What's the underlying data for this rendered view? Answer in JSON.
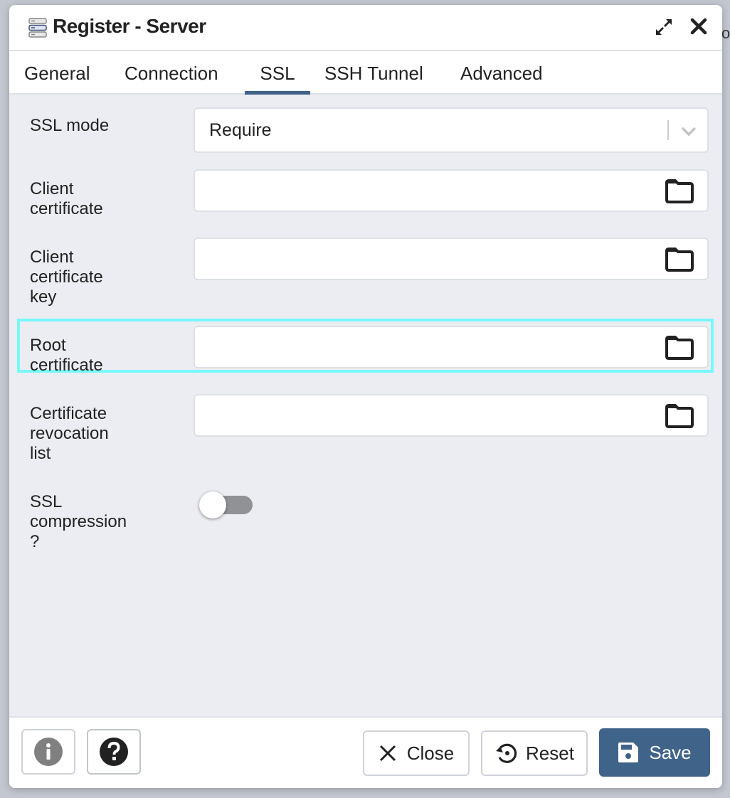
{
  "background_partial_text": "o",
  "dialog": {
    "title": "Register - Server",
    "icons": {
      "title": "server-icon",
      "maximize": "expand-icon",
      "close": "close-icon"
    }
  },
  "tabs": [
    {
      "label": "General",
      "active": false
    },
    {
      "label": "Connection",
      "active": false
    },
    {
      "label": "SSL",
      "active": true
    },
    {
      "label": "SSH Tunnel",
      "active": false
    },
    {
      "label": "Advanced",
      "active": false
    }
  ],
  "form": {
    "ssl_mode": {
      "label": "SSL mode",
      "value": "Require",
      "icon": "chevron-down-icon"
    },
    "client_certificate": {
      "label_lines": [
        "Client",
        "certificate"
      ],
      "value": "",
      "icon": "folder-icon"
    },
    "client_certificate_key": {
      "label_lines": [
        "Client",
        "certificate",
        "key"
      ],
      "value": "",
      "icon": "folder-icon"
    },
    "root_certificate": {
      "label_lines": [
        "Root",
        "certificate"
      ],
      "value": "",
      "icon": "folder-icon",
      "highlighted": true
    },
    "certificate_revocation_list": {
      "label_lines": [
        "Certificate",
        "revocation",
        "list"
      ],
      "value": "",
      "icon": "folder-icon"
    },
    "ssl_compression": {
      "label_lines": [
        "SSL",
        "compression",
        "?"
      ],
      "value": false
    }
  },
  "footer": {
    "info_icon": "info-icon",
    "help_icon": "help-icon",
    "close_label": "Close",
    "reset_label": "Reset",
    "save_label": "Save"
  },
  "colors": {
    "accent": "#3f6389",
    "highlight": "#77f8fa",
    "content_bg": "#ebedf2",
    "toggle_off": "#919296"
  }
}
